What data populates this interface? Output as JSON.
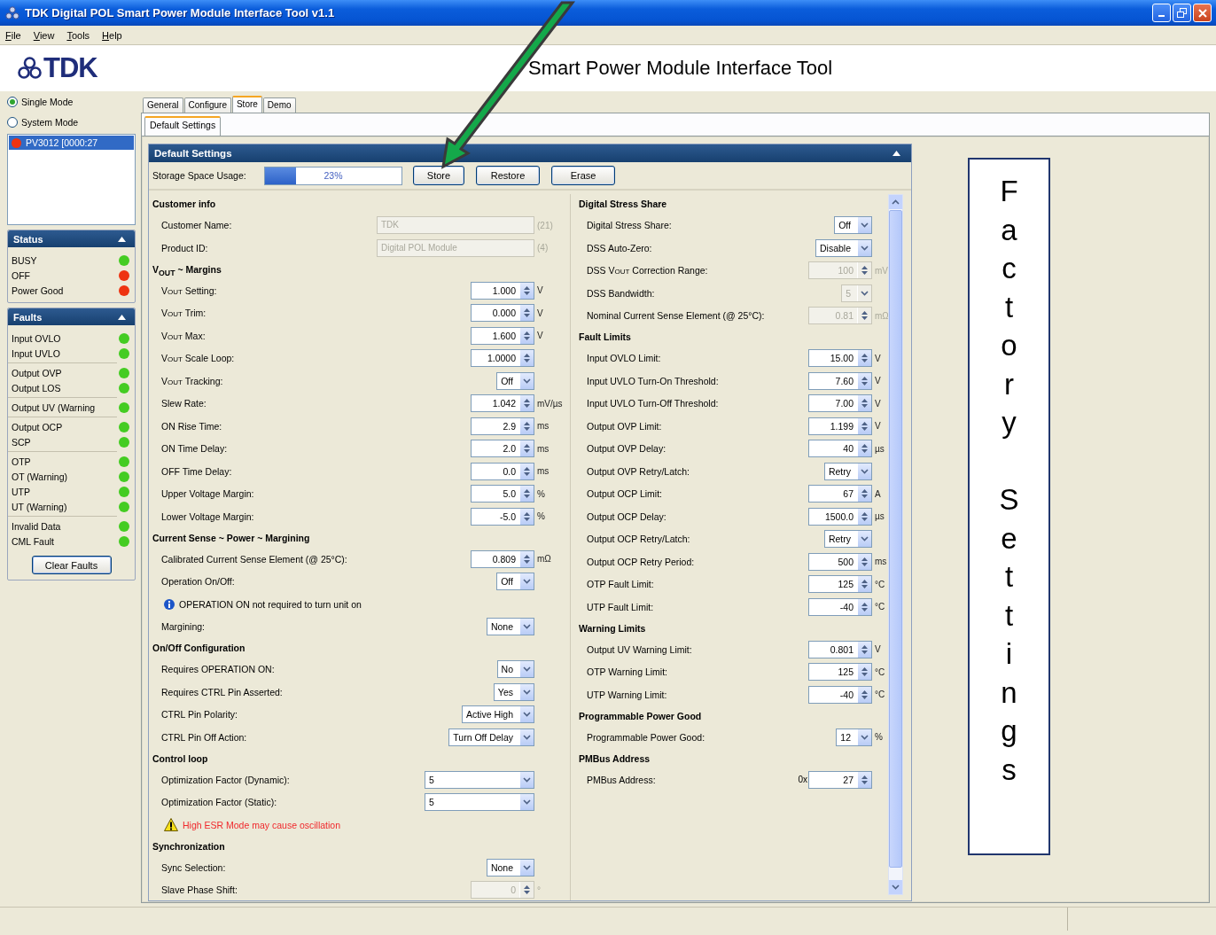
{
  "window": {
    "title": "TDK Digital POL Smart Power Module Interface Tool v1.1"
  },
  "menu": [
    "File",
    "View",
    "Tools",
    "Help"
  ],
  "header": {
    "logo": "TDK",
    "title": "Smart Power Module Interface Tool"
  },
  "mode": [
    {
      "label": "Single Mode",
      "selected": true
    },
    {
      "label": "System Mode",
      "selected": false
    }
  ],
  "devices": [
    {
      "label": "PV3012 [0000:27",
      "selected": true,
      "color": "#ee3311"
    }
  ],
  "status": {
    "title": "Status",
    "items": [
      {
        "label": "BUSY",
        "color": "#44cc22"
      },
      {
        "label": "OFF",
        "color": "#ee3311"
      },
      {
        "label": "Power Good",
        "color": "#ee3311"
      }
    ]
  },
  "faults": {
    "title": "Faults",
    "groups": [
      [
        {
          "label": "Input OVLO",
          "color": "#44cc22"
        },
        {
          "label": "Input UVLO",
          "color": "#44cc22"
        }
      ],
      [
        {
          "label": "Output OVP",
          "color": "#44cc22"
        },
        {
          "label": "Output LOS",
          "color": "#44cc22"
        }
      ],
      [
        {
          "label": "Output UV (Warning",
          "color": "#44cc22"
        }
      ],
      [
        {
          "label": "Output OCP",
          "color": "#44cc22"
        },
        {
          "label": "SCP",
          "color": "#44cc22"
        }
      ],
      [
        {
          "label": "OTP",
          "color": "#44cc22"
        },
        {
          "label": "OT (Warning)",
          "color": "#44cc22"
        },
        {
          "label": "UTP",
          "color": "#44cc22"
        },
        {
          "label": "UT (Warning)",
          "color": "#44cc22"
        }
      ],
      [
        {
          "label": "Invalid Data",
          "color": "#44cc22"
        },
        {
          "label": "CML Fault",
          "color": "#44cc22"
        }
      ]
    ],
    "button": "Clear Faults"
  },
  "tabs": [
    {
      "label": "General",
      "selected": false
    },
    {
      "label": "Configure",
      "selected": false
    },
    {
      "label": "Store",
      "selected": true
    },
    {
      "label": "Demo",
      "selected": false
    }
  ],
  "subtabs": [
    {
      "label": "Default Settings",
      "selected": true
    }
  ],
  "panel": {
    "title": "Default Settings",
    "storage": {
      "label": "Storage Space Usage:",
      "level": 0.23,
      "reading": "23%"
    },
    "buttons": [
      "Store",
      "Restore",
      "Erase"
    ],
    "columns": [
      {
        "sections": [
          {
            "title": "Customer info",
            "rows": [
              {
                "kind": "text",
                "label": "Customer Name:",
                "value": "TDK",
                "unit": "(21)",
                "disabled": true
              },
              {
                "kind": "text",
                "label": "Product ID:",
                "value": "Digital POL Module",
                "unit": "(4)",
                "disabled": true
              }
            ]
          },
          {
            "title": "V$_{OUT}$ ~ Margins",
            "rows": [
              {
                "kind": "spin",
                "label": "V$_{OUT}$ Setting:",
                "value": "1.000",
                "unit": "V",
                "disabled": false
              },
              {
                "kind": "spin",
                "label": "V$_{OUT}$ Trim:",
                "value": "0.000",
                "unit": "V",
                "disabled": false
              },
              {
                "kind": "spin",
                "label": "V$_{OUT}$ Max:",
                "value": "1.600",
                "unit": "V",
                "disabled": false
              },
              {
                "kind": "spin",
                "label": "V$_{OUT}$ Scale Loop:",
                "value": "1.0000",
                "disabled": false
              },
              {
                "kind": "combo",
                "label": "V$_{OUT}$ Tracking:",
                "value": "Off",
                "disabled": false
              },
              {
                "kind": "spin",
                "label": "Slew Rate:",
                "value": "1.042",
                "unit": "mV/µs",
                "disabled": false
              },
              {
                "kind": "spin",
                "label": "ON Rise Time:",
                "value": "2.9",
                "unit": "ms",
                "disabled": false
              },
              {
                "kind": "spin",
                "label": "ON Time Delay:",
                "value": "2.0",
                "unit": "ms",
                "disabled": false
              },
              {
                "kind": "spin",
                "label": "OFF Time Delay:",
                "value": "0.0",
                "unit": "ms",
                "disabled": false
              },
              {
                "kind": "spin",
                "label": "Upper Voltage Margin:",
                "value": "5.0",
                "unit": "%",
                "disabled": false
              },
              {
                "kind": "spin",
                "label": "Lower Voltage Margin:",
                "value": "-5.0",
                "unit": "%",
                "disabled": false
              }
            ]
          },
          {
            "title": "Current Sense ~ Power ~ Margining",
            "rows": [
              {
                "kind": "spin",
                "label": "Calibrated Current Sense Element (@ 25°C):",
                "value": "0.809",
                "unit": "mΩ",
                "disabled": false
              },
              {
                "kind": "combo",
                "label": "Operation On/Off:",
                "value": "Off",
                "disabled": false
              },
              {
                "kind": "info",
                "label": "OPERATION ON not required to turn unit on",
                "disabled": false
              },
              {
                "kind": "combo",
                "label": "Margining:",
                "value": "None",
                "disabled": false
              }
            ]
          },
          {
            "title": "On/Off Configuration",
            "rows": [
              {
                "kind": "combo",
                "label": "Requires OPERATION ON:",
                "value": "No",
                "disabled": false
              },
              {
                "kind": "combo",
                "label": "Requires CTRL Pin Asserted:",
                "value": "Yes",
                "disabled": false
              },
              {
                "kind": "combo",
                "label": "CTRL Pin Polarity:",
                "value": "Active High",
                "disabled": false
              },
              {
                "kind": "combo",
                "label": "CTRL Pin Off Action:",
                "value": "Turn Off Delay",
                "disabled": false
              }
            ]
          },
          {
            "title": "Control loop",
            "rows": [
              {
                "kind": "wide-combo",
                "label": "Optimization Factor (Dynamic):",
                "value": "5",
                "disabled": false
              },
              {
                "kind": "wide-combo",
                "label": "Optimization Factor (Static):",
                "value": "5",
                "disabled": false
              },
              {
                "kind": "warning",
                "label": "High ESR Mode may cause oscillation",
                "disabled": false
              }
            ]
          },
          {
            "title": "Synchronization",
            "rows": [
              {
                "kind": "combo",
                "label": "Sync Selection:",
                "value": "None",
                "disabled": false
              },
              {
                "kind": "spin",
                "label": "Slave Phase Shift:",
                "value": "0",
                "unit": "°",
                "disabled": true
              }
            ]
          }
        ]
      },
      {
        "sections": [
          {
            "title": "Digital Stress Share",
            "rows": [
              {
                "kind": "combo",
                "label": "Digital Stress Share:",
                "value": "Off",
                "disabled": false
              },
              {
                "kind": "combo",
                "label": "DSS Auto-Zero:",
                "value": "Disable",
                "disabled": false
              },
              {
                "kind": "spin",
                "label": "DSS V$_{OUT}$ Correction Range:",
                "value": "100",
                "unit": "mV",
                "disabled": true
              },
              {
                "kind": "combo",
                "label": "DSS Bandwidth:",
                "value": "5",
                "disabled": true
              },
              {
                "kind": "spin",
                "label": "Nominal Current Sense Element (@ 25°C):",
                "value": "0.81",
                "unit": "mΩ",
                "disabled": true
              }
            ]
          },
          {
            "title": "Fault Limits",
            "rows": [
              {
                "kind": "spin",
                "label": "Input OVLO Limit:",
                "value": "15.00",
                "unit": "V",
                "disabled": false
              },
              {
                "kind": "spin",
                "label": "Input UVLO Turn-On Threshold:",
                "value": "7.60",
                "unit": "V",
                "disabled": false
              },
              {
                "kind": "spin",
                "label": "Input UVLO Turn-Off Threshold:",
                "value": "7.00",
                "unit": "V",
                "disabled": false
              },
              {
                "kind": "spin",
                "label": "Output OVP Limit:",
                "value": "1.199",
                "unit": "V",
                "disabled": false
              },
              {
                "kind": "spin",
                "label": "Output OVP Delay:",
                "value": "40",
                "unit": "µs",
                "disabled": false
              },
              {
                "kind": "combo",
                "label": "Output OVP Retry/Latch:",
                "value": "Retry",
                "disabled": false
              },
              {
                "kind": "spin",
                "label": "Output OCP Limit:",
                "value": "67",
                "unit": "A",
                "disabled": false
              },
              {
                "kind": "spin",
                "label": "Output OCP Delay:",
                "value": "1500.0",
                "unit": "µs",
                "disabled": false
              },
              {
                "kind": "combo",
                "label": "Output OCP Retry/Latch:",
                "value": "Retry",
                "disabled": false
              },
              {
                "kind": "spin",
                "label": "Output OCP Retry Period:",
                "value": "500",
                "unit": "ms",
                "disabled": false
              },
              {
                "kind": "spin",
                "label": "OTP Fault Limit:",
                "value": "125",
                "unit": "°C",
                "disabled": false
              },
              {
                "kind": "spin",
                "label": "UTP Fault Limit:",
                "value": "-40",
                "unit": "°C",
                "disabled": false
              }
            ]
          },
          {
            "title": "Warning Limits",
            "rows": [
              {
                "kind": "spin",
                "label": "Output UV Warning Limit:",
                "value": "0.801",
                "unit": "V",
                "disabled": false
              },
              {
                "kind": "spin",
                "label": "OTP Warning Limit:",
                "value": "125",
                "unit": "°C",
                "disabled": false
              },
              {
                "kind": "spin",
                "label": "UTP Warning Limit:",
                "value": "-40",
                "unit": "°C",
                "disabled": false
              }
            ]
          },
          {
            "title": "Programmable Power Good",
            "rows": [
              {
                "kind": "combo",
                "label": "Programmable Power Good:",
                "value": "12",
                "unit": "%",
                "disabled": false
              }
            ]
          },
          {
            "title": "PMBus Address",
            "rows": [
              {
                "kind": "spin",
                "label": "PMBus Address:",
                "prefix": "0x",
                "value": "27",
                "disabled": false
              }
            ]
          }
        ]
      }
    ]
  },
  "side_note": {
    "text": "Factory Settings"
  },
  "annotations": [
    {
      "kind": "arrow"
    }
  ]
}
